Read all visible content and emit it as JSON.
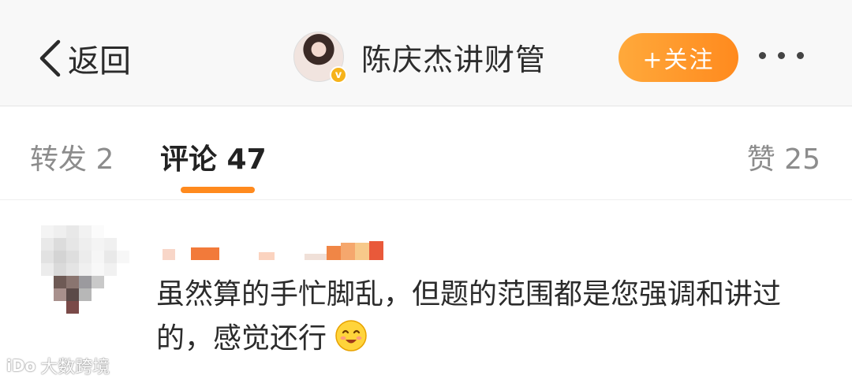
{
  "header": {
    "back_label": "返回",
    "username": "陈庆杰讲财管",
    "verified_badge": "v",
    "follow_label": "+关注",
    "more_icon": "more-dots-icon",
    "accent_color": "#ff8a1e"
  },
  "tabs": [
    {
      "label": "转发 2"
    },
    {
      "label": "评论 47"
    },
    {
      "label": "赞 25"
    }
  ],
  "comment": {
    "text": "虽然算的手忙脚乱，但题的范围都是您强调和讲过的，感觉还行",
    "emoji": "smiling-face-emoji"
  },
  "watermark": {
    "text": "大数跨境",
    "logo": "iDo"
  }
}
